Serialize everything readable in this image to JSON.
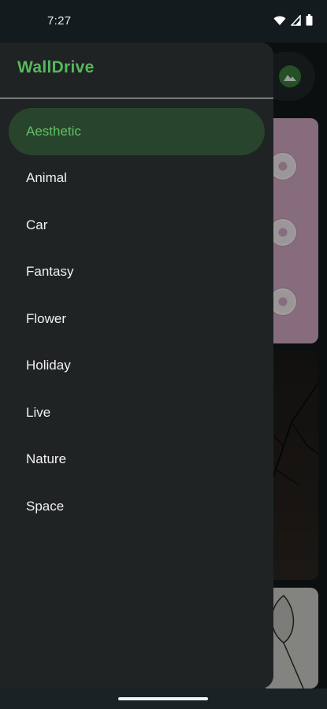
{
  "status_bar": {
    "time": "7:27",
    "icons": [
      "wifi-icon",
      "cellular-signal-icon",
      "battery-icon"
    ]
  },
  "drawer": {
    "app_title": "WallDrive",
    "items": [
      {
        "label": "Aesthetic",
        "selected": true
      },
      {
        "label": "Animal"
      },
      {
        "label": "Car"
      },
      {
        "label": "Fantasy"
      },
      {
        "label": "Flower"
      },
      {
        "label": "Holiday"
      },
      {
        "label": "Live"
      },
      {
        "label": "Nature"
      },
      {
        "label": "Space"
      }
    ]
  },
  "colors": {
    "accent": "#56b85a",
    "selected_bg": "#29442d",
    "drawer_bg": "#1f2324",
    "text": "#f1f3f2"
  }
}
